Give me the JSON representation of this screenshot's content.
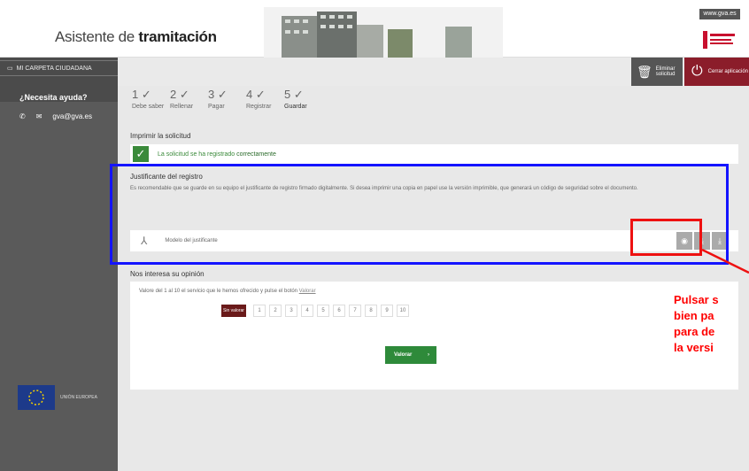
{
  "header": {
    "title_prefix": "Asistente de ",
    "title_bold": "tramitación",
    "gva_link": "www.gva.es"
  },
  "sidebar": {
    "carpeta": "MI CARPETA CIUDADANA",
    "help_title": "¿Necesita ayuda?",
    "help_contact": "gva@gva.es",
    "eu_text": "UNIÓN EUROPEA"
  },
  "topbar": {
    "delete_label": "Eliminar solicitud",
    "close_label": "Cerrar aplicación"
  },
  "steps": [
    {
      "num": "1",
      "label": "Debe saber"
    },
    {
      "num": "2",
      "label": "Rellenar"
    },
    {
      "num": "3",
      "label": "Pagar"
    },
    {
      "num": "4",
      "label": "Registrar"
    },
    {
      "num": "5",
      "label": "Guardar"
    }
  ],
  "main": {
    "imprimir_title": "Imprimir la solicitud",
    "ok_text": "La solicitud se ha registrado ",
    "ok_text_strong": "correctamente",
    "justificante_title": "Justificante del registro",
    "justificante_desc": "Es recomendable que se guarde en su equipo el justificante de registro firmado digitalmente. Si desea imprimir una copia en papel use la versión imprimible, que generará un código de seguridad sobre el documento.",
    "file_name": "Modelo del justificante",
    "survey_title": "Nos interesa su opinión",
    "survey_question": "Valore del 1 al 10 el servicio que le hemos ofrecido y pulse el botón ",
    "survey_link": "Valorar",
    "rate_none": "Sin valorar",
    "ratings": [
      "1",
      "2",
      "3",
      "4",
      "5",
      "6",
      "7",
      "8",
      "9",
      "10"
    ],
    "valorar_label": "Valorar"
  },
  "annotation": {
    "lines": [
      "Pulsar s",
      "bien pa",
      "para de",
      "la versi"
    ]
  },
  "colors": {
    "annotation_red": "#ff0000",
    "highlight_blue": "#1414ff",
    "success_green": "#3a8a3a",
    "close_red": "#8b1d2a"
  }
}
